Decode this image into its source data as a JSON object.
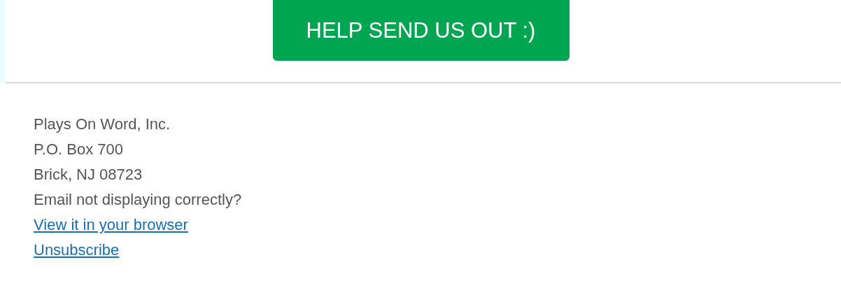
{
  "cta_button": {
    "label": "HELP SEND US OUT :)"
  },
  "footer": {
    "lines": [
      "Plays On Word, Inc.",
      "P.O. Box 700",
      "Brick, NJ 08723",
      "Email not displaying correctly?"
    ],
    "links": [
      {
        "label": "View it in your browser"
      },
      {
        "label": "Unsubscribe"
      }
    ]
  }
}
